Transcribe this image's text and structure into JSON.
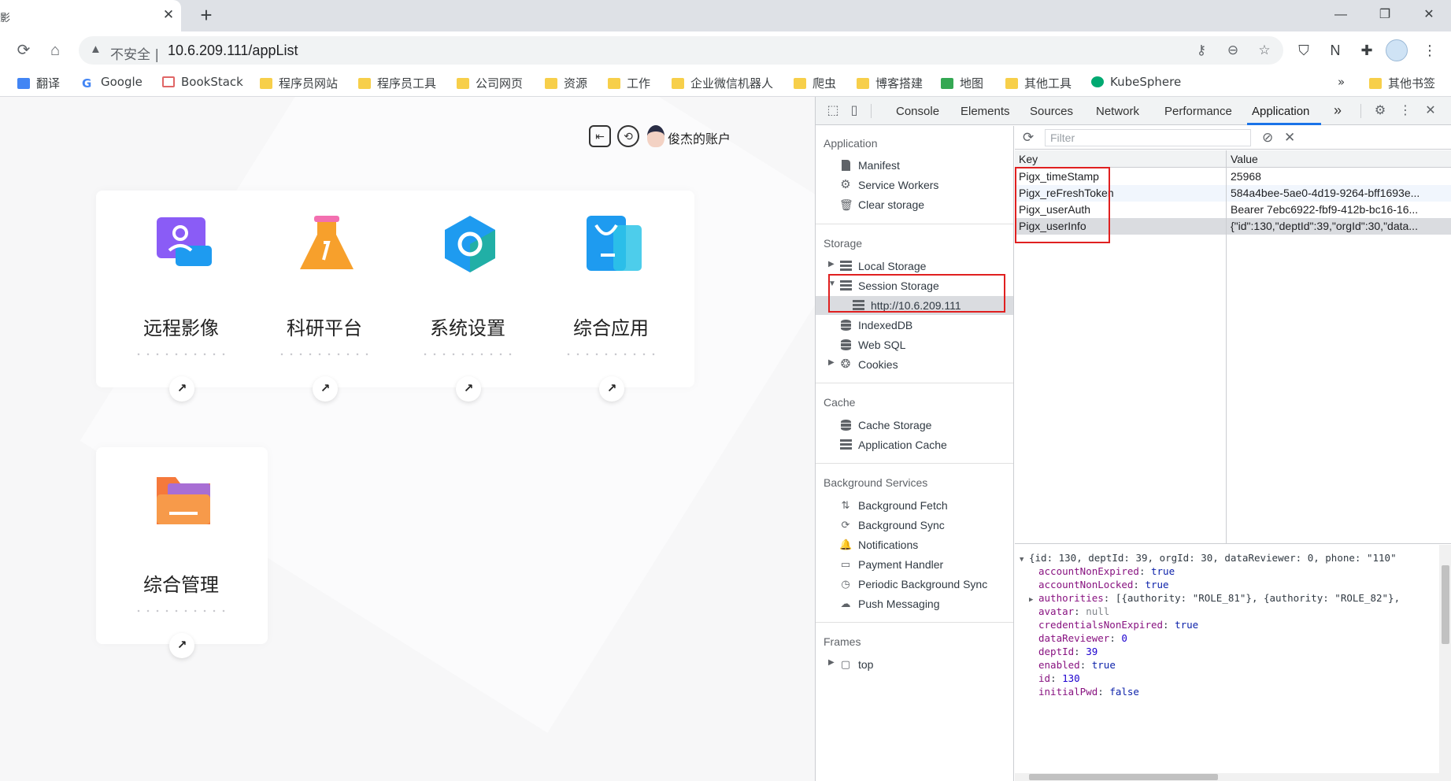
{
  "browser": {
    "tab": {
      "title": "影",
      "close": "✕"
    },
    "new_tab": "+",
    "window": {
      "minimize": "—",
      "restore": "❐",
      "close": "✕"
    },
    "omnibox": {
      "warning": "▲",
      "insecure_label": "不安全 |",
      "url": "10.6.209.111/appList"
    }
  },
  "bookmarks": [
    {
      "label": "翻译",
      "icon": "translate-icon"
    },
    {
      "label": "Google",
      "icon": "google-icon"
    },
    {
      "label": "BookStack",
      "icon": "bookstack-icon"
    },
    {
      "label": "程序员网站",
      "icon": "folder-icon"
    },
    {
      "label": "程序员工具",
      "icon": "folder-icon"
    },
    {
      "label": "公司网页",
      "icon": "folder-icon"
    },
    {
      "label": "资源",
      "icon": "folder-icon"
    },
    {
      "label": "工作",
      "icon": "folder-icon"
    },
    {
      "label": "企业微信机器人",
      "icon": "folder-icon"
    },
    {
      "label": "爬虫",
      "icon": "folder-icon"
    },
    {
      "label": "博客搭建",
      "icon": "folder-icon"
    },
    {
      "label": "地图",
      "icon": "map-icon"
    },
    {
      "label": "其他工具",
      "icon": "folder-icon"
    },
    {
      "label": "KubeSphere",
      "icon": "kubesphere-icon"
    },
    {
      "label": "»",
      "icon": "chevron-more-icon"
    },
    {
      "label": "其他书签",
      "icon": "folder-icon"
    }
  ],
  "page": {
    "account_name": "俊杰的账户",
    "apps": [
      {
        "label": "远程影像",
        "arrow": "↗",
        "color": "#7b5cf5"
      },
      {
        "label": "科研平台",
        "arrow": "↗",
        "color": "#f7a02c"
      },
      {
        "label": "系统设置",
        "arrow": "↗",
        "color": "#1e9bf0"
      },
      {
        "label": "综合应用",
        "arrow": "↗",
        "color": "#2aa8f0"
      },
      {
        "label": "综合管理",
        "arrow": "↗",
        "color": "#f5793b"
      }
    ]
  },
  "devtools": {
    "tabs": [
      "Console",
      "Elements",
      "Sources",
      "Network",
      "Performance",
      "Application"
    ],
    "active_tab": "Application",
    "more_tabs": "»",
    "sidebar": {
      "application_title": "Application",
      "application_items": [
        "Manifest",
        "Service Workers",
        "Clear storage"
      ],
      "storage_title": "Storage",
      "storage_items": {
        "local": "Local Storage",
        "session": "Session Storage",
        "session_origin": "http://10.6.209.111",
        "indexeddb": "IndexedDB",
        "websql": "Web SQL",
        "cookies": "Cookies"
      },
      "cache_title": "Cache",
      "cache_items": [
        "Cache Storage",
        "Application Cache"
      ],
      "bg_title": "Background Services",
      "bg_items": [
        "Background Fetch",
        "Background Sync",
        "Notifications",
        "Payment Handler",
        "Periodic Background Sync",
        "Push Messaging"
      ],
      "frames_title": "Frames",
      "frames_items": [
        "top"
      ]
    },
    "filter_placeholder": "Filter",
    "table": {
      "headers": {
        "key": "Key",
        "value": "Value"
      },
      "rows": [
        {
          "key": "Pigx_timeStamp",
          "value": "25968"
        },
        {
          "key": "Pigx_reFreshToken",
          "value": "584a4bee-5ae0-4d19-9264-bff1693e..."
        },
        {
          "key": "Pigx_userAuth",
          "value": "Bearer 7ebc6922-fbf9-412b-bc16-16..."
        },
        {
          "key": "Pigx_userInfo",
          "value": "{\"id\":130,\"deptId\":39,\"orgId\":30,\"data..."
        }
      ]
    },
    "preview": {
      "summary": "{id: 130, deptId: 39, orgId: 30, dataReviewer: 0, phone: \"110\"",
      "props": [
        {
          "k": "accountNonExpired",
          "v": "true",
          "t": "kw"
        },
        {
          "k": "accountNonLocked",
          "v": "true",
          "t": "kw"
        },
        {
          "k": "authorities",
          "v": "[{authority: \"ROLE_81\"}, {authority: \"ROLE_82\"},",
          "t": "plain",
          "expand": true
        },
        {
          "k": "avatar",
          "v": "null",
          "t": "plain"
        },
        {
          "k": "credentialsNonExpired",
          "v": "true",
          "t": "kw"
        },
        {
          "k": "dataReviewer",
          "v": "0",
          "t": "num"
        },
        {
          "k": "deptId",
          "v": "39",
          "t": "num"
        },
        {
          "k": "enabled",
          "v": "true",
          "t": "kw"
        },
        {
          "k": "id",
          "v": "130",
          "t": "num"
        },
        {
          "k": "initialPwd",
          "v": "false",
          "t": "kw"
        }
      ]
    }
  }
}
